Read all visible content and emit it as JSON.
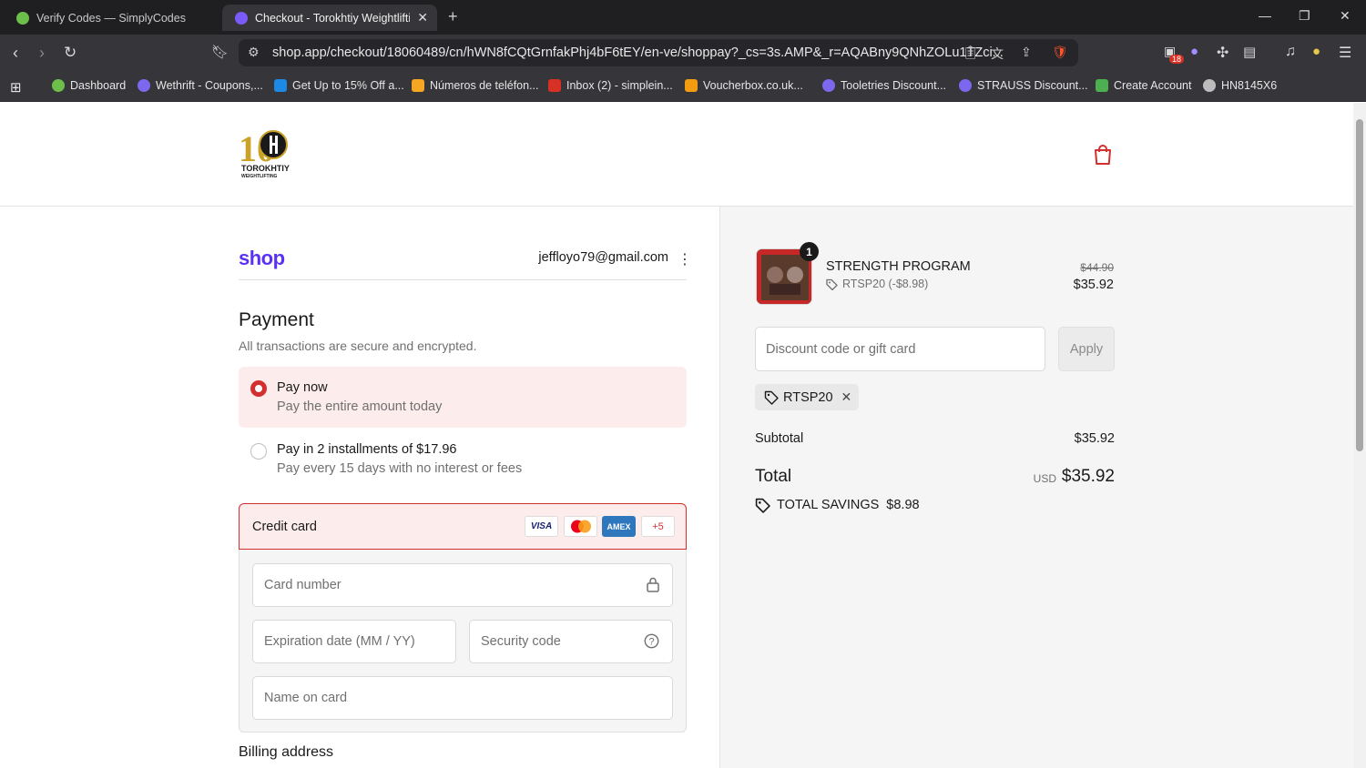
{
  "browser": {
    "tabs": [
      {
        "title": "Verify Codes — SimplyCodes",
        "favicon_color": "#6cc04a"
      },
      {
        "title": "Checkout - Torokhtiy Weightlifting",
        "favicon_color": "#7a5af8"
      }
    ],
    "url": "shop.app/checkout/18060489/cn/hWN8fCQtGrnfakPhj4bF6tEY/en-ve/shoppay?_cs=3s.AMP&_r=AQABny9QNhZOLu1TZci...",
    "extension_badge": "18",
    "bookmarks": [
      {
        "label": "Dashboard",
        "color": "#6cc04a"
      },
      {
        "label": "Wethrift - Coupons,...",
        "color": "#7b68ee"
      },
      {
        "label": "Get Up to 15% Off a...",
        "color": "#1e88e5"
      },
      {
        "label": "Números de teléfon...",
        "color": "#f5a623"
      },
      {
        "label": "Inbox (2) - simplein...",
        "color": "#d93025"
      },
      {
        "label": "Voucherbox.co.uk...",
        "color": "#f39c12"
      },
      {
        "label": "Tooletries Discount...",
        "color": "#7b68ee"
      },
      {
        "label": "STRAUSS Discount...",
        "color": "#7b68ee"
      },
      {
        "label": "Create Account",
        "color": "#4caf50"
      },
      {
        "label": "HN8145X6",
        "color": "#bdbdbd"
      }
    ]
  },
  "header": {
    "logo_text": "TOROKHTIY",
    "logo_sub": "WEIGHTLIFTING",
    "logo_years": "10"
  },
  "account": {
    "shop_logo": "shop",
    "email": "jeffloyo79@gmail.com"
  },
  "payment": {
    "title": "Payment",
    "subtitle": "All transactions are secure and encrypted.",
    "option_pay_now": "Pay now",
    "option_pay_now_sub": "Pay the entire amount today",
    "option_installments": "Pay in 2 installments of $17.96",
    "option_installments_sub": "Pay every 15 days with no interest or fees",
    "credit_card_label": "Credit card",
    "card_brands": [
      "VISA",
      "",
      "AMEX",
      "+5"
    ],
    "card_number_placeholder": "Card number",
    "expiration_placeholder": "Expiration date (MM / YY)",
    "security_placeholder": "Security code",
    "name_placeholder": "Name on card",
    "billing_title": "Billing address"
  },
  "summary": {
    "product_name": "STRENGTH PROGRAM",
    "quantity": "1",
    "discount_line": "RTSP20 (-$8.98)",
    "original_price": "$44.90",
    "price": "$35.92",
    "discount_placeholder": "Discount code or gift card",
    "apply_label": "Apply",
    "applied_code": "RTSP20",
    "subtotal_label": "Subtotal",
    "subtotal_value": "$35.92",
    "total_label": "Total",
    "currency": "USD",
    "total_value": "$35.92",
    "savings_label": "TOTAL SAVINGS",
    "savings_value": "$8.98"
  },
  "colors": {
    "accent": "#d32f2f",
    "shop_purple": "#5a31f4"
  }
}
